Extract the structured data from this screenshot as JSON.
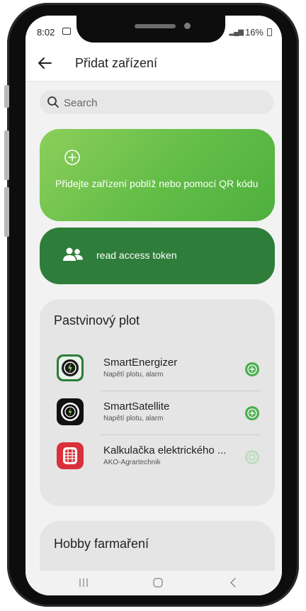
{
  "status": {
    "time": "8:02",
    "battery_text": "16%"
  },
  "appbar": {
    "title": "Přidat zařízení"
  },
  "search": {
    "placeholder": "Search"
  },
  "cards": {
    "add_text": "Přidejte zařízení poblíž nebo pomocí QR kódu",
    "token_text": "read access token"
  },
  "sections": [
    {
      "title": "Pastvinový plot",
      "devices": [
        {
          "name": "SmartEnergizer",
          "subtitle": "Napětí plotu, alarm",
          "icon": "smart-energizer-icon"
        },
        {
          "name": "SmartSatellite",
          "subtitle": "Napětí plotu, alarm",
          "icon": "smart-satellite-icon"
        },
        {
          "name": "Kalkulačka elektrického ...",
          "subtitle": "AKO-Agrartechnik",
          "icon": "fence-calculator-icon"
        }
      ]
    },
    {
      "title": "Hobby farmaření"
    }
  ],
  "colors": {
    "accent_green": "#4caf50",
    "dark_green": "#2f7d3a",
    "light_green": "#8ccf5a"
  }
}
